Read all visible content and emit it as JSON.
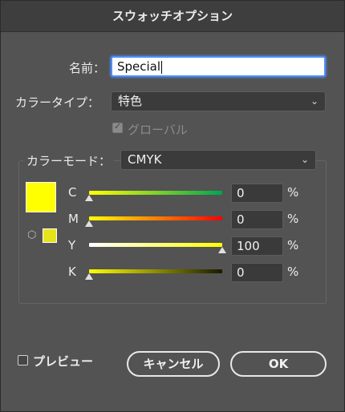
{
  "dialog": {
    "title": "スウォッチオプション",
    "name_label": "名前：",
    "name_value": "Special",
    "color_type_label": "カラータイプ：",
    "color_type_value": "特色",
    "global_label": "グローバル",
    "global_checked": true,
    "color_mode_label": "カラーモード：",
    "color_mode_value": "CMYK",
    "swatch_color": "#ffff00",
    "channels": [
      {
        "label": "C",
        "value": "0",
        "unit": "%",
        "level": 0
      },
      {
        "label": "M",
        "value": "0",
        "unit": "%",
        "level": 0
      },
      {
        "label": "Y",
        "value": "100",
        "unit": "%",
        "level": 100
      },
      {
        "label": "K",
        "value": "0",
        "unit": "%",
        "level": 0
      }
    ],
    "preview_label": "プレビュー",
    "preview_checked": false,
    "cancel_label": "キャンセル",
    "ok_label": "OK",
    "icons": {
      "dropdown": "chevron-down-icon",
      "checkmark": "checkmark-icon",
      "out_of_gamut": "cube-icon"
    }
  }
}
